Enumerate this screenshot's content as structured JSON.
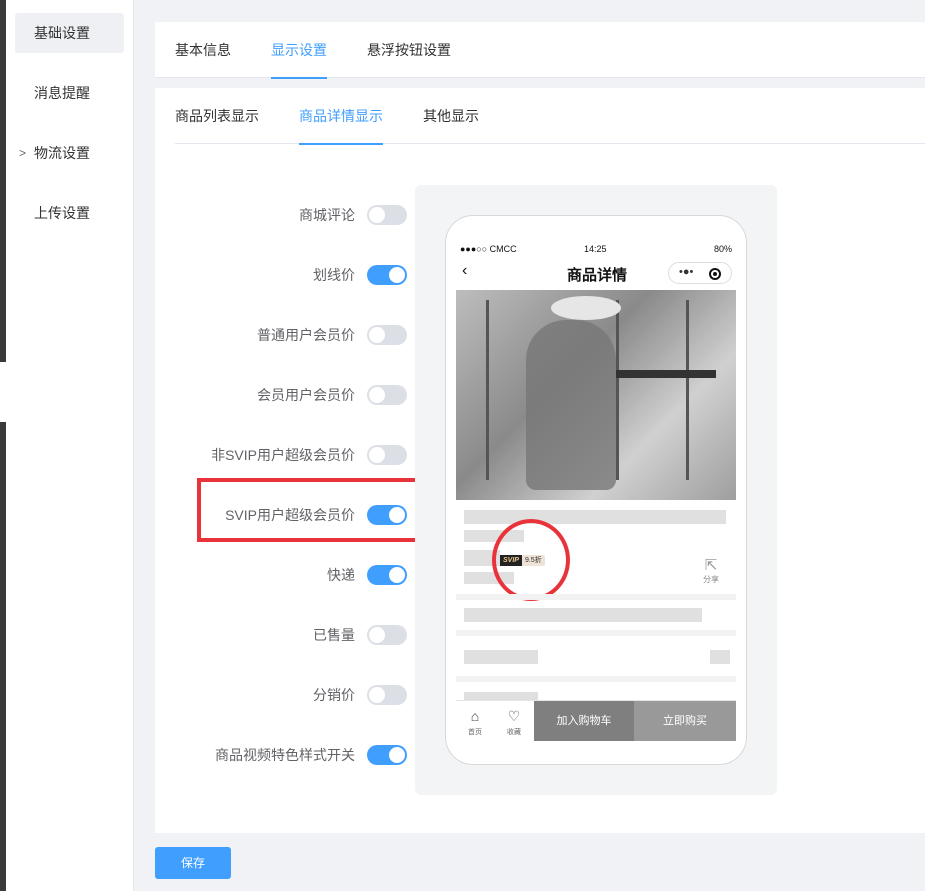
{
  "sidebar": {
    "items": [
      {
        "label": "基础设置",
        "active": true
      },
      {
        "label": "消息提醒"
      },
      {
        "label": "物流设置",
        "has_children": true
      },
      {
        "label": "上传设置"
      }
    ]
  },
  "top_tabs": [
    {
      "label": "基本信息"
    },
    {
      "label": "显示设置",
      "active": true
    },
    {
      "label": "悬浮按钮设置"
    }
  ],
  "sub_tabs": [
    {
      "label": "商品列表显示"
    },
    {
      "label": "商品详情显示",
      "active": true
    },
    {
      "label": "其他显示"
    }
  ],
  "settings": [
    {
      "label": "商城评论",
      "on": false
    },
    {
      "label": "划线价",
      "on": true
    },
    {
      "label": "普通用户会员价",
      "on": false
    },
    {
      "label": "会员用户会员价",
      "on": false
    },
    {
      "label": "非SVIP用户超级会员价",
      "on": false
    },
    {
      "label": "SVIP用户超级会员价",
      "on": true,
      "highlighted": true
    },
    {
      "label": "快递",
      "on": true
    },
    {
      "label": "已售量",
      "on": false
    },
    {
      "label": "分销价",
      "on": false
    },
    {
      "label": "商品视频特色样式开关",
      "on": true
    }
  ],
  "preview": {
    "status": {
      "carrier": "●●●○○ CMCC",
      "time": "14:25",
      "battery": "80%"
    },
    "nav_title": "商品详情",
    "back_icon": "‹",
    "capsule_dots": "•●•",
    "svip_tag": "SVIP",
    "svip_discount": "9.5折",
    "share_label": "分享",
    "bottom": {
      "home_label": "首页",
      "fav_label": "收藏",
      "cart_label": "加入购物车",
      "buy_label": "立即购买"
    }
  },
  "save_label": "保存",
  "colors": {
    "primary": "#409eff",
    "highlight": "#e8333a",
    "switch_off": "#dcdfe6"
  }
}
